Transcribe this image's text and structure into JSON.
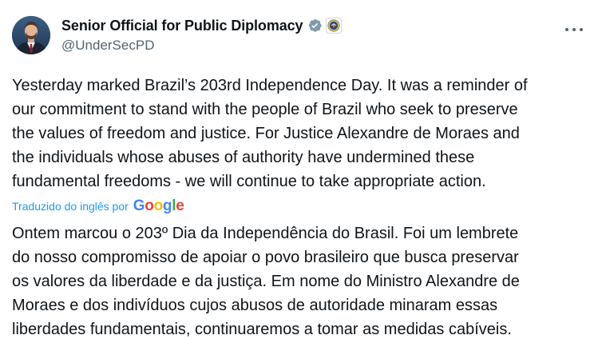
{
  "author": {
    "display_name": "Senior Official for Public Diplomacy",
    "handle": "@UnderSecPD",
    "verified_badge_color": "#829aab",
    "avatar_icon": "person-photo"
  },
  "tweet": {
    "text_lines": [
      "Yesterday marked Brazil’s 203rd Independence Day. It was a reminder of",
      "our commitment to stand with the people of Brazil who seek to preserve",
      "the values of freedom and justice. For Justice Alexandre de Moraes and",
      "the individuals whose abuses of authority have undermined these",
      "fundamental freedoms - we will continue to take appropriate action."
    ]
  },
  "translation": {
    "label": "Traduzido do inglês por",
    "provider_letters": [
      "G",
      "o",
      "o",
      "g",
      "l",
      "e"
    ],
    "text_lines": [
      "Ontem marcou o 203º Dia da Independência do Brasil. Foi um lembrete",
      "do nosso compromisso de apoiar o povo brasileiro que busca preservar",
      "os valores da liberdade e da justiça. Em nome do Ministro Alexandre de",
      "Moraes e dos indivíduos cujos abusos de autoridade minaram essas",
      "liberdades fundamentais, continuaremos a tomar as medidas cabíveis."
    ]
  },
  "colors": {
    "text": "#0f1419",
    "secondary": "#536471",
    "link": "#1d9bf0"
  }
}
